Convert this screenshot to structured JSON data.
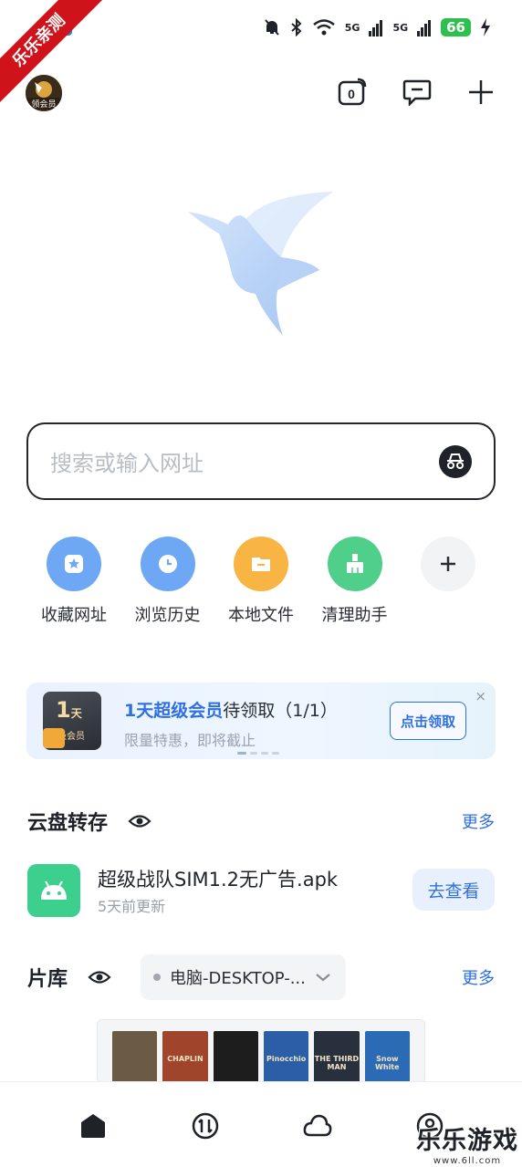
{
  "watermark": {
    "ribbon_text": "乐乐亲测",
    "corner_text": "乐乐游戏",
    "corner_sub": "www.6ll.com"
  },
  "status_bar": {
    "battery": "66",
    "signal_1": "5G",
    "signal_2": "5G",
    "icons": [
      "bell-off-icon",
      "bluetooth-icon",
      "wifi-icon",
      "signal-icon",
      "signal-icon",
      "charging-icon"
    ]
  },
  "header": {
    "avatar_label": "领会员",
    "tab_count": "0",
    "icons": [
      "tabs-icon",
      "message-icon",
      "plus-icon"
    ]
  },
  "search": {
    "placeholder": "搜索或输入网址"
  },
  "shortcuts": [
    {
      "label": "收藏网址",
      "icon": "bookmark-icon",
      "color": "#6ea8f5"
    },
    {
      "label": "浏览历史",
      "icon": "clock-icon",
      "color": "#6ea8f5"
    },
    {
      "label": "本地文件",
      "icon": "folder-icon",
      "color": "#f8b544"
    },
    {
      "label": "清理助手",
      "icon": "broom-icon",
      "color": "#4fcf8a"
    },
    {
      "label": "",
      "icon": "add-icon",
      "color": "#f2f3f5"
    }
  ],
  "promo": {
    "card_number": "1",
    "card_unit": "天",
    "card_sub": "超级会员",
    "title_highlight": "1天超级会员",
    "title_rest": "待领取（1/1）",
    "subtitle": "限量特惠，即将截止",
    "button": "点击领取",
    "close": "×"
  },
  "cloud": {
    "title": "云盘转存",
    "more": "更多",
    "file_name": "超级战队SIM1.2无广告.apk",
    "file_time": "5天前更新",
    "file_button": "去查看"
  },
  "library": {
    "title": "片库",
    "more": "更多",
    "device": "电脑-DESKTOP-...",
    "posters": [
      {
        "caption": "",
        "color": "#6b5a44"
      },
      {
        "caption": "CHAPLIN",
        "color": "#a0442c"
      },
      {
        "caption": "",
        "color": "#1d1d1d"
      },
      {
        "caption": "Pinocchio",
        "color": "#2a5fa8"
      },
      {
        "caption": "THE THIRD MAN",
        "color": "#27303c"
      },
      {
        "caption": "Snow White",
        "color": "#2b6ab5"
      }
    ]
  },
  "bottom_nav": [
    "home-icon",
    "transfer-icon",
    "cloud-icon",
    "profile-icon"
  ]
}
